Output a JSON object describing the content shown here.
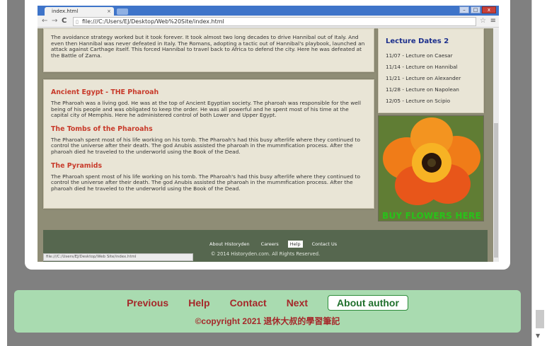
{
  "browser": {
    "tab_title": "index.html",
    "tab_close": "×",
    "window_buttons": [
      "–",
      "□",
      "x"
    ],
    "nav_glyphs": {
      "back": "←",
      "forward": "→",
      "reload": "C"
    },
    "url": "file:///C:/Users/EJ/Desktop/Web%20Site/index.html",
    "star_glyph": "☆",
    "menu_glyph": "≡",
    "status_url": "file:///C:/Users/EJ/Desktop/Web Site/index.html"
  },
  "article": {
    "intro": "The avoidance strategy worked but it took forever. It took almost two long decades to drive Hannibal out of Italy. And even then Hannibal was never defeated in Italy. The Romans, adopting a tactic out of Hannibal's playbook, launched an attack against Carthage itself. This forced Hannibal to travel back to Africa to defend the city. Here he was defeated at the Battle of Zama.",
    "sections": [
      {
        "heading": "Ancient Egypt - THE Pharoah",
        "text": "The Pharoah was a living god. He was at the top of Ancient Egyptian society. The pharoah was responsible for the well being of his people and was obligated to keep the order. He was all powerful and he spent most of his time at the capital city of Memphis. Here he administered control of both Lower and Upper Egypt."
      },
      {
        "heading": "The Tombs of the Pharoahs",
        "text": "The Pharoah spent most of his life working on his tomb. The Pharoah's had this busy afterlife where they continued to control the universe after their death. The god Anubis assisted the pharoah in the mummfication process. After the pharoah died he traveled to the underworld using the Book of the Dead."
      },
      {
        "heading": "The Pyramids",
        "text": "The Pharoah spent most of his life working on his tomb. The Pharoah's had this busy afterlife where they continued to control the universe after their death. The god Anubis assisted the pharoah in the mummfication process. After the pharoah died he traveled to the underworld using the Book of the Dead."
      }
    ]
  },
  "sidebar": {
    "title": "Lecture Dates 2",
    "items": [
      "11/07 - Lecture on Caesar",
      "11/14 - Lecture on Hannibal",
      "11/21 - Lecture on Alexander",
      "11/28 - Lecture on Napolean",
      "12/05 - Lecture on Scipio"
    ],
    "ad_text": "BUY FLOWERS HERE"
  },
  "site_footer": {
    "links": [
      "About Historyden",
      "Careers",
      "Help",
      "Contact Us"
    ],
    "active_index": 2,
    "copyright": "© 2014 Historyden.com. All Rights Reserved."
  },
  "page_nav": {
    "previous": "Previous",
    "help": "Help",
    "contact": "Contact",
    "next": "Next",
    "about_author": "About author",
    "copyright": "©copyright 2021 退休大叔的學習筆記"
  },
  "colors": {
    "accent_red": "#a5282a",
    "nav_bg": "#a9dbb0",
    "section_heading": "#c83a2a",
    "sidebar_title": "#1c2f8c",
    "ad_green": "#28c21a"
  }
}
